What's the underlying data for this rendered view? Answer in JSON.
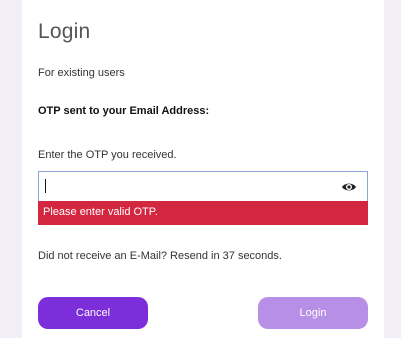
{
  "dialog": {
    "title": "Login",
    "subtitle": "For existing users",
    "otp_sent_label": "OTP sent to your Email Address:",
    "input_label": "Enter the OTP you received.",
    "otp_value": "",
    "error_message": "Please enter valid OTP.",
    "resend_message": "Did not receive an E-Mail? Resend in 37 seconds.",
    "cancel_label": "Cancel",
    "login_label": "Login"
  },
  "icons": {
    "password_toggle": "eye-icon"
  },
  "colors": {
    "accent": "#7b2ed9",
    "accent_disabled": "#b88fe6",
    "error": "#d32740",
    "background": "#f2eef8"
  }
}
